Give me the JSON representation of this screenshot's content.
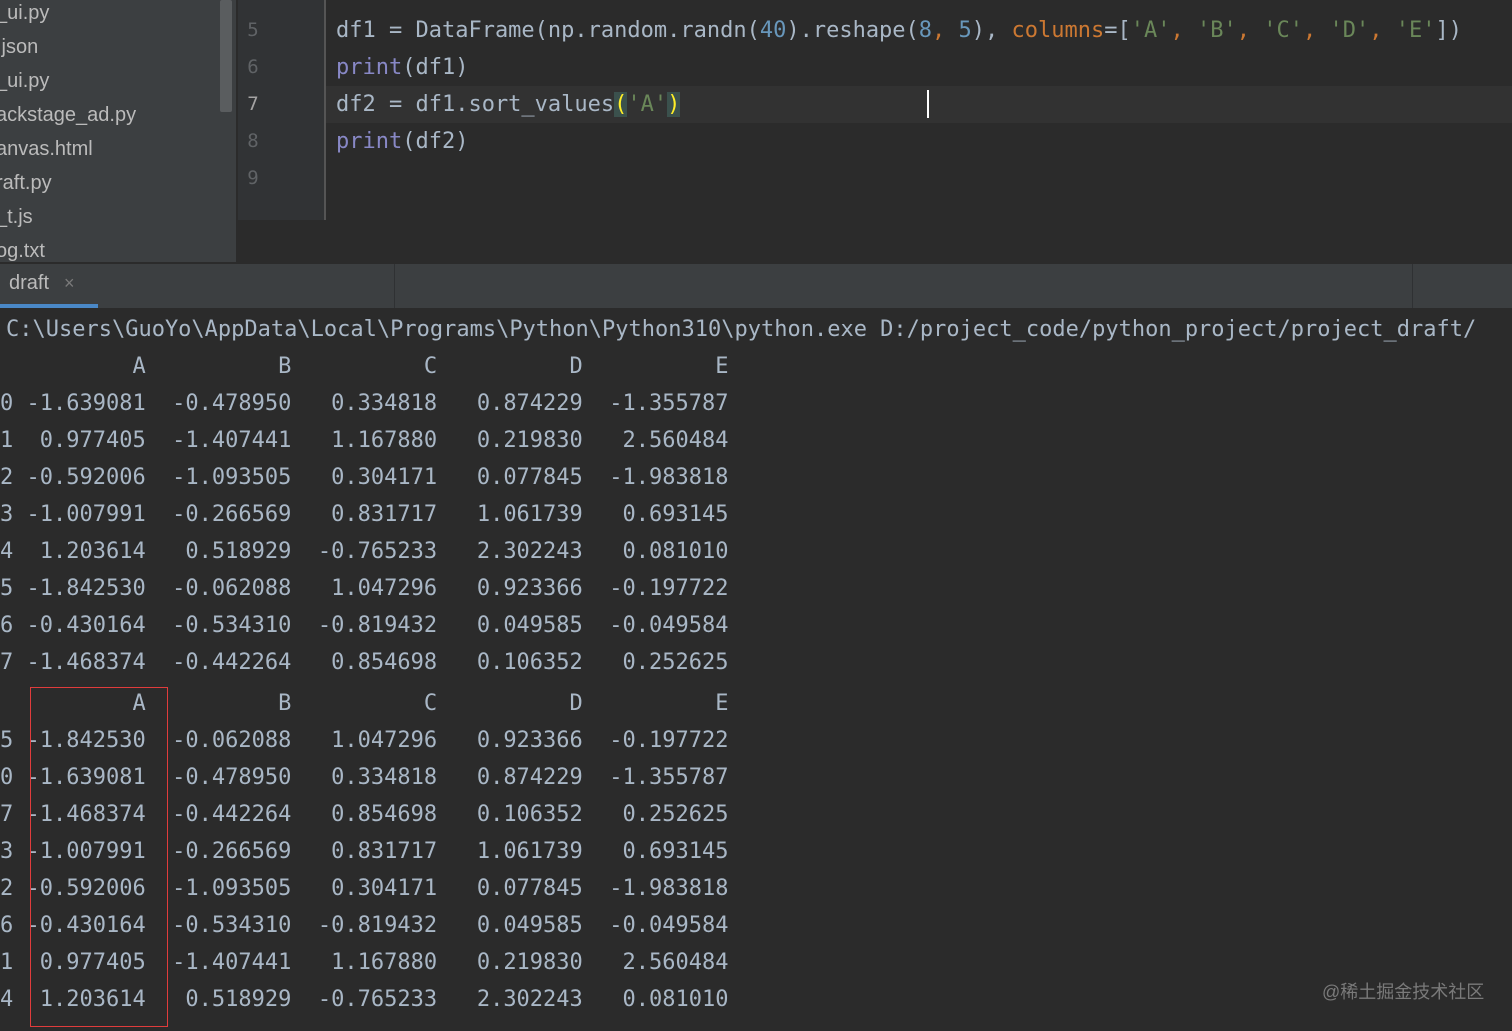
{
  "project_tree": {
    "files": [
      "_ui.py",
      ".json",
      "_ui.py",
      "ackstage_ad.py",
      "anvas.html",
      "raft.py",
      "_t.js",
      "og.txt"
    ]
  },
  "editor": {
    "line_numbers": [
      "5",
      "6",
      "7",
      "8",
      "9"
    ],
    "active_line": "7",
    "code": {
      "line5": {
        "a": "df1 = DataFrame(np.random.randn(",
        "n1": "40",
        "b": ").reshape(",
        "n2": "8",
        "c": ", ",
        "n3": "5",
        "d": "), ",
        "kw": "columns",
        "e": "=[",
        "s1": "'A'",
        "f1": ", ",
        "s2": "'B'",
        "f2": ", ",
        "s3": "'C'",
        "f3": ", ",
        "s4": "'D'",
        "f4": ", ",
        "s5": "'E'",
        "g": "])"
      },
      "line6": {
        "fn": "print",
        "rest": "(df1)"
      },
      "line7": {
        "a": "df2 = df1.sort_values",
        "lp": "(",
        "str": "'A'",
        "rp": ")"
      },
      "line8": {
        "fn": "print",
        "rest": "(df2)"
      }
    }
  },
  "run": {
    "tab_label": "draft",
    "close_glyph": "×"
  },
  "console": {
    "command": "C:\\Users\\GuoYo\\AppData\\Local\\Programs\\Python\\Python310\\python.exe D:/project_code/python_project/project_draft/",
    "columns": [
      "A",
      "B",
      "C",
      "D",
      "E"
    ],
    "df1": [
      [
        "0",
        "-1.639081",
        "-0.478950",
        "0.334818",
        "0.874229",
        "-1.355787"
      ],
      [
        "1",
        "0.977405",
        "-1.407441",
        "1.167880",
        "0.219830",
        "2.560484"
      ],
      [
        "2",
        "-0.592006",
        "-1.093505",
        "0.304171",
        "0.077845",
        "-1.983818"
      ],
      [
        "3",
        "-1.007991",
        "-0.266569",
        "0.831717",
        "1.061739",
        "0.693145"
      ],
      [
        "4",
        "1.203614",
        "0.518929",
        "-0.765233",
        "2.302243",
        "0.081010"
      ],
      [
        "5",
        "-1.842530",
        "-0.062088",
        "1.047296",
        "0.923366",
        "-0.197722"
      ],
      [
        "6",
        "-0.430164",
        "-0.534310",
        "-0.819432",
        "0.049585",
        "-0.049584"
      ],
      [
        "7",
        "-1.468374",
        "-0.442264",
        "0.854698",
        "0.106352",
        "0.252625"
      ]
    ],
    "df2": [
      [
        "5",
        "-1.842530",
        "-0.062088",
        "1.047296",
        "0.923366",
        "-0.197722"
      ],
      [
        "0",
        "-1.639081",
        "-0.478950",
        "0.334818",
        "0.874229",
        "-1.355787"
      ],
      [
        "7",
        "-1.468374",
        "-0.442264",
        "0.854698",
        "0.106352",
        "0.252625"
      ],
      [
        "3",
        "-1.007991",
        "-0.266569",
        "0.831717",
        "1.061739",
        "0.693145"
      ],
      [
        "2",
        "-0.592006",
        "-1.093505",
        "0.304171",
        "0.077845",
        "-1.983818"
      ],
      [
        "6",
        "-0.430164",
        "-0.534310",
        "-0.819432",
        "0.049585",
        "-0.049584"
      ],
      [
        "1",
        "0.977405",
        "-1.407441",
        "1.167880",
        "0.219830",
        "2.560484"
      ],
      [
        "4",
        "1.203614",
        "0.518929",
        "-0.765233",
        "2.302243",
        "0.081010"
      ]
    ],
    "highlight_color": "#e03c3c"
  },
  "watermark": "@稀土掘金技术社区"
}
